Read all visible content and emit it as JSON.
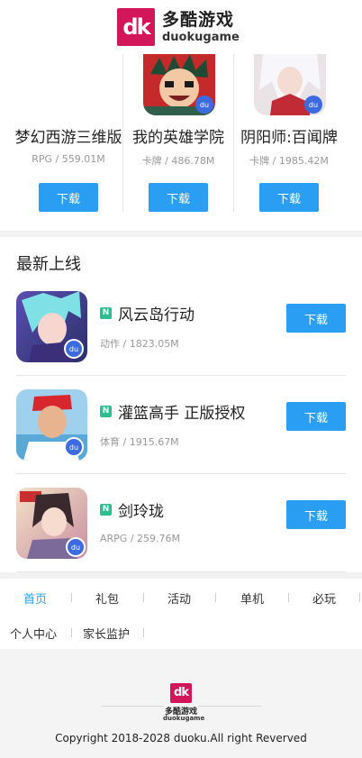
{
  "header": {
    "logo_mark": "dk",
    "logo_cn": "多酷游戏",
    "logo_en": "duokugame"
  },
  "carousel": {
    "items": [
      {
        "name": "梦幻西游三维版",
        "meta": "RPG / 559.01M",
        "download_label": "下载"
      },
      {
        "name": "我的英雄学院",
        "meta": "卡牌 / 486.78M",
        "download_label": "下载"
      },
      {
        "name": "阴阳师:百闻牌",
        "meta": "卡牌 / 1985.42M",
        "download_label": "下载"
      }
    ]
  },
  "new_section": {
    "title": "最新上线",
    "items": [
      {
        "tag": "N",
        "name": "风云岛行动",
        "meta": "动作 / 1823.05M",
        "download_label": "下载"
      },
      {
        "tag": "N",
        "name": "灌篮高手 正版授权",
        "meta": "体育 / 1915.67M",
        "download_label": "下载"
      },
      {
        "tag": "N",
        "name": "剑玲珑",
        "meta": "ARPG / 259.76M",
        "download_label": "下载"
      }
    ]
  },
  "footer_nav": {
    "items": [
      "首页",
      "礼包",
      "活动",
      "单机",
      "必玩",
      "个人中心",
      "家长监护"
    ],
    "separator": "|"
  },
  "footer": {
    "logo_mark": "dk",
    "logo_cn": "多酷游戏",
    "logo_en": "duokugame",
    "copyright": "Copyright 2018-2028 duoku.All right Reverved"
  },
  "colors": {
    "accent": "#2a9ef2",
    "brand": "#d3155a",
    "new_tag": "#2ebd8f"
  }
}
